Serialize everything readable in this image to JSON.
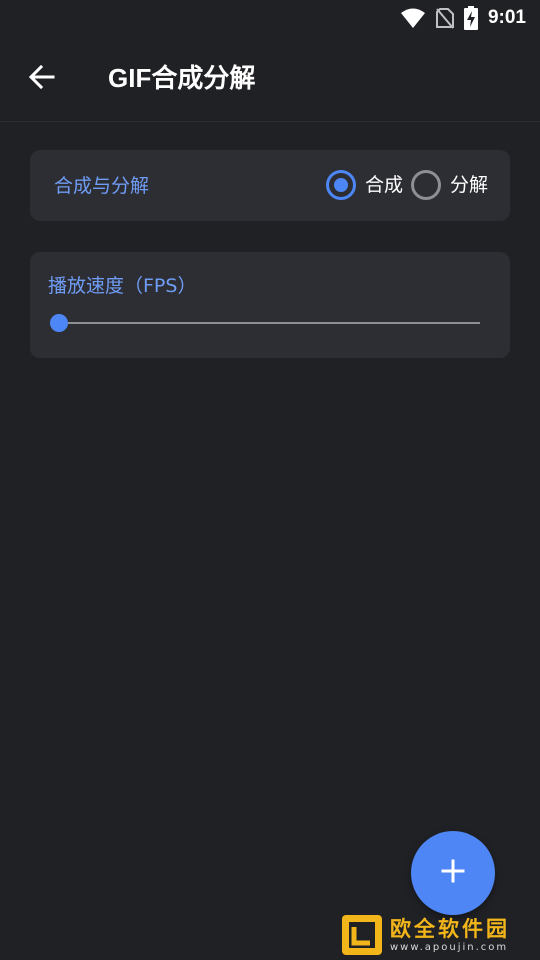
{
  "status_bar": {
    "time": "9:01",
    "icons": [
      "wifi-icon",
      "no-sim-icon",
      "battery-charging-icon"
    ]
  },
  "app_bar": {
    "back_icon": "arrow-left-icon",
    "title": "GIF合成分解"
  },
  "mode_card": {
    "label": "合成与分解",
    "options": [
      {
        "label": "合成",
        "selected": true
      },
      {
        "label": "分解",
        "selected": false
      }
    ]
  },
  "fps_card": {
    "label": "播放速度（FPS）",
    "slider_value": 0
  },
  "fab": {
    "icon": "plus-icon"
  },
  "watermark": {
    "text": "欧全软件园",
    "url": "www.apoujin.com"
  },
  "colors": {
    "background": "#202125",
    "card": "#2d2e33",
    "accent": "#4d86f7",
    "label": "#6f9cf5"
  }
}
